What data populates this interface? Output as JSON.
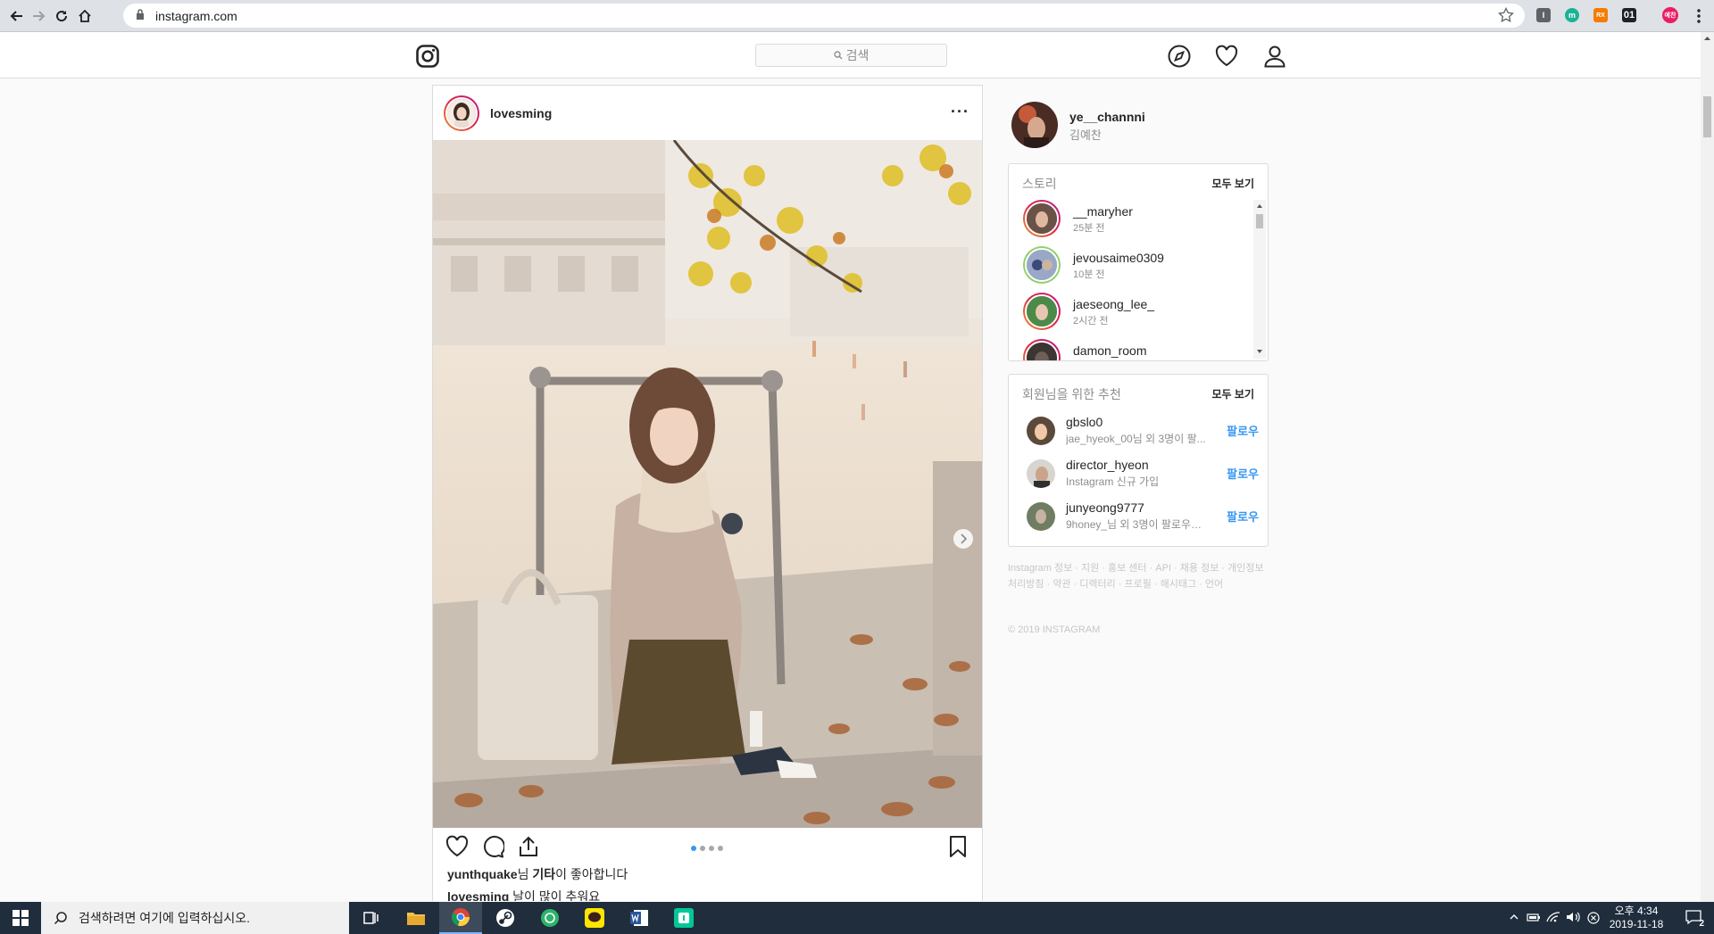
{
  "browser": {
    "url": "instagram.com",
    "extensions": [
      {
        "icon": "i-ext-icon",
        "label": "I",
        "color": "#5f6368"
      },
      {
        "icon": "m-ext-icon",
        "label": "m",
        "color": "#1ab394"
      },
      {
        "icon": "rx-ext-icon",
        "label": "RX",
        "color": "#f57c00"
      },
      {
        "icon": "01-ext-icon",
        "label": "01",
        "color": "#202124"
      },
      {
        "icon": "profile-avatar-icon",
        "label": "예찬",
        "color": "#e91e63"
      }
    ]
  },
  "header": {
    "search_placeholder": "검색"
  },
  "post": {
    "username": "lovesming",
    "more": "···",
    "carousel_count": 4,
    "carousel_active": 0,
    "likes_user": "yunthquake",
    "likes_mid": "님 ",
    "likes_bold": "기타",
    "likes_tail": "이 좋아합니다",
    "caption_user": "lovesming",
    "caption_text": " 날이 많이 추워요"
  },
  "sidebar": {
    "me": {
      "username": "ye__channni",
      "name": "김예찬"
    },
    "stories": {
      "title": "스토리",
      "see_all": "모두 보기",
      "items": [
        {
          "username": "__maryher",
          "time": "25분 전"
        },
        {
          "username": "jevousaime0309",
          "time": "10분 전"
        },
        {
          "username": "jaeseong_lee_",
          "time": "2시간 전"
        },
        {
          "username": "damon_room",
          "time": ""
        }
      ]
    },
    "suggestions": {
      "title": "회원님을 위한 추천",
      "see_all": "모두 보기",
      "items": [
        {
          "username": "gbslo0",
          "sub": "jae_hyeok_00님 외 3명이 팔...",
          "action": "팔로우"
        },
        {
          "username": "director_hyeon",
          "sub": "Instagram 신규 가입",
          "action": "팔로우"
        },
        {
          "username": "junyeong9777",
          "sub": "9honey_님 외 3명이 팔로우합...",
          "action": "팔로우"
        }
      ]
    },
    "footer_links": "Instagram 정보 · 지원 · 홍보 센터 · API · 채용 정보 · 개인정보처리방침 · 약관 · 디렉터리 · 프로필 · 해시태그 · 언어",
    "copyright": "© 2019 INSTAGRAM"
  },
  "taskbar": {
    "search_placeholder": "검색하려면 여기에 입력하십시오.",
    "apps": [
      "task-view-icon",
      "file-explorer-icon",
      "chrome-icon",
      "steam-icon",
      "green-app-icon",
      "kakaotalk-icon",
      "word-icon",
      "line-app-icon"
    ],
    "time_period": "오후 4:34",
    "date": "2019-11-18",
    "notification_count": "2"
  }
}
